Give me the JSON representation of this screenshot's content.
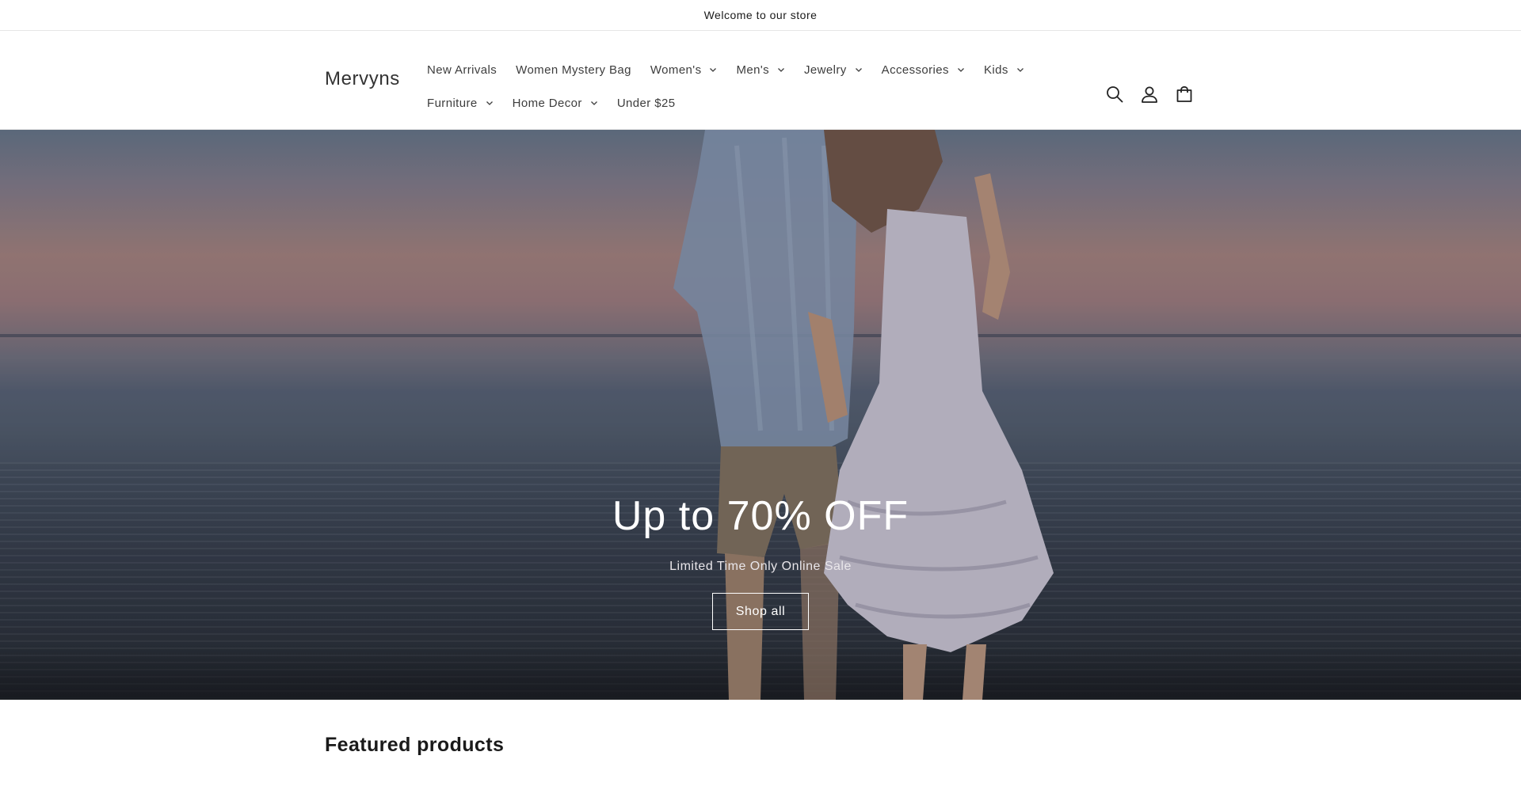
{
  "announcement": {
    "text": "Welcome to our store"
  },
  "header": {
    "logo": "Mervyns",
    "nav": [
      {
        "label": "New Arrivals",
        "has_dropdown": false
      },
      {
        "label": "Women Mystery Bag",
        "has_dropdown": false
      },
      {
        "label": "Women's",
        "has_dropdown": true
      },
      {
        "label": "Men's",
        "has_dropdown": true
      },
      {
        "label": "Jewelry",
        "has_dropdown": true
      },
      {
        "label": "Accessories",
        "has_dropdown": true
      },
      {
        "label": "Kids",
        "has_dropdown": true
      },
      {
        "label": "Furniture",
        "has_dropdown": true
      },
      {
        "label": "Home Decor",
        "has_dropdown": true
      },
      {
        "label": "Under $25",
        "has_dropdown": false
      }
    ],
    "icons": [
      "search-icon",
      "account-icon",
      "cart-icon"
    ]
  },
  "hero": {
    "title": "Up to 70% OFF",
    "subtitle": "Limited Time Only Online Sale",
    "button": "Shop all"
  },
  "featured": {
    "title": "Featured products"
  },
  "colors": {
    "text": "#121212",
    "nav_text": "#3d3d3d",
    "border": "#e6e6e6",
    "hero_text": "#ffffff"
  }
}
